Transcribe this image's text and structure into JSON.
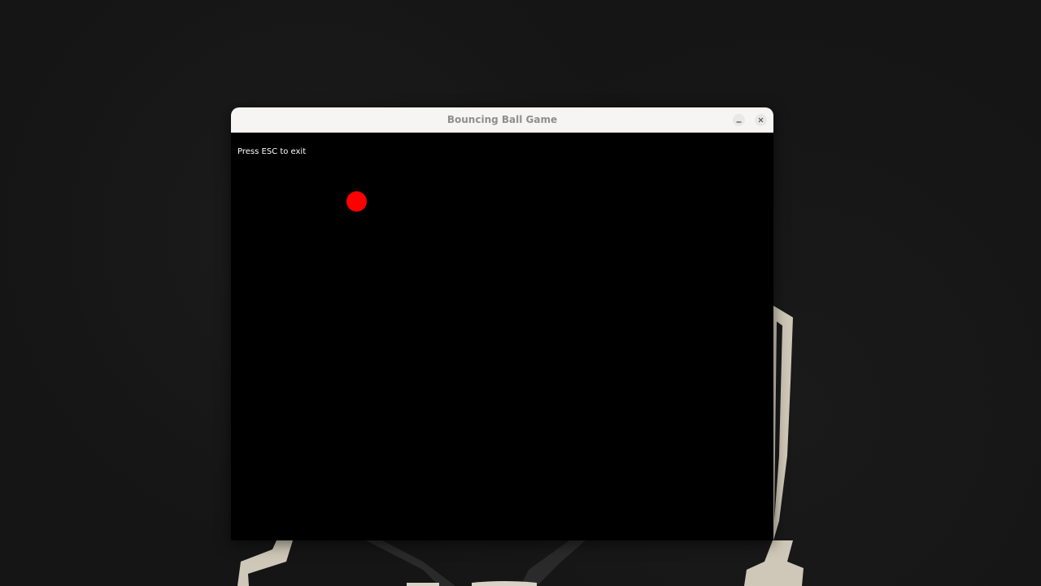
{
  "window": {
    "title": "Bouncing Ball Game",
    "controls": {
      "minimize_icon": "minimize-icon",
      "close_icon": "close-icon"
    }
  },
  "game": {
    "hint_text": "Press ESC to exit",
    "ball_color": "#ff0000",
    "background_color": "#000000"
  }
}
